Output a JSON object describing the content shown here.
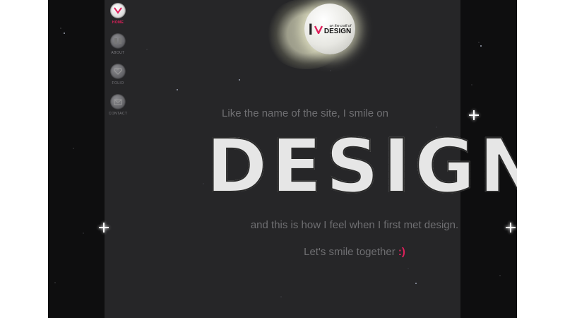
{
  "nav": {
    "items": [
      {
        "label": "HOME",
        "icon": "heart-v-icon",
        "active": true
      },
      {
        "label": "ABOUT",
        "icon": "info-icon",
        "active": false
      },
      {
        "label": "FOLIO",
        "icon": "heart-icon",
        "active": false
      },
      {
        "label": "CONTACT",
        "icon": "envelope-icon",
        "active": false
      }
    ]
  },
  "logo": {
    "letter_i": "I",
    "tagline": "on the craft of",
    "word": "DESIGN"
  },
  "content": {
    "intro": "Like the name of the site, I smile on",
    "big_word": "DESIGN",
    "outro": "and this is how I feel when I first met design.",
    "smile_text": "Let's smile together",
    "smiley": ":)"
  },
  "colors": {
    "accent": "#e0205c",
    "text_gray": "#6f6f72",
    "background": "#0e0e0f",
    "panel": "#262628"
  }
}
